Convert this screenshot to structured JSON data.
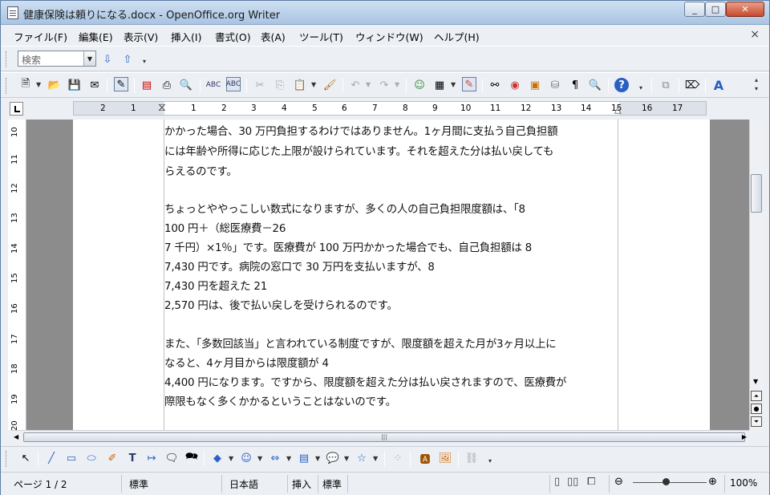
{
  "window": {
    "title": "健康保険は頼りになる.docx - OpenOffice.org Writer",
    "minimize": "_",
    "maximize": "□",
    "close": "✕"
  },
  "menu": [
    "ファイル(F)",
    "編集(E)",
    "表示(V)",
    "挿入(I)",
    "書式(O)",
    "表(A)",
    "ツール(T)",
    "ウィンドウ(W)",
    "ヘルプ(H)"
  ],
  "menu_doc_close": "×",
  "find": {
    "placeholder": "検索"
  },
  "ruler": {
    "numbers": [
      "2",
      "1",
      "1",
      "2",
      "3",
      "4",
      "5",
      "6",
      "7",
      "8",
      "9",
      "10",
      "11",
      "12",
      "13",
      "14",
      "15",
      "16",
      "17"
    ]
  },
  "vruler": [
    "10",
    "11",
    "12",
    "13",
    "14",
    "15",
    "16",
    "17",
    "18",
    "19",
    "20"
  ],
  "document": {
    "lines": [
      "かかった場合、30 万円負担するわけではありません。1ヶ月間に支払う自己負担額",
      "には年齢や所得に応じた上限が設けられています。それを超えた分は払い戻しても",
      "らえるのです。",
      "",
      "ちょっとややっこしい数式になりますが、多くの人の自己負担限度額は、「8",
      "100 円＋（総医療費－26",
      "7 千円）×1％」です。医療費が 100 万円かかった場合でも、自己負担額は 8",
      "7,430 円です。病院の窓口で 30 万円を支払いますが、8",
      "7,430 円を超えた 21",
      "2,570 円は、後で払い戻しを受けられるのです。",
      "",
      "また、「多数回該当」と言われている制度ですが、限度額を超えた月が3ヶ月以上に",
      "なると、4ヶ月目からは限度額が 4",
      "4,400 円になります。ですから、限度額を超えた分は払い戻されますので、医療費が",
      "際限もなく多くかかるということはないのです。"
    ]
  },
  "status": {
    "page": "ページ 1 / 2",
    "style": "標準",
    "language": "日本語",
    "insert_mode": "挿入",
    "selection_mode": "標準",
    "zoom": "100%"
  }
}
